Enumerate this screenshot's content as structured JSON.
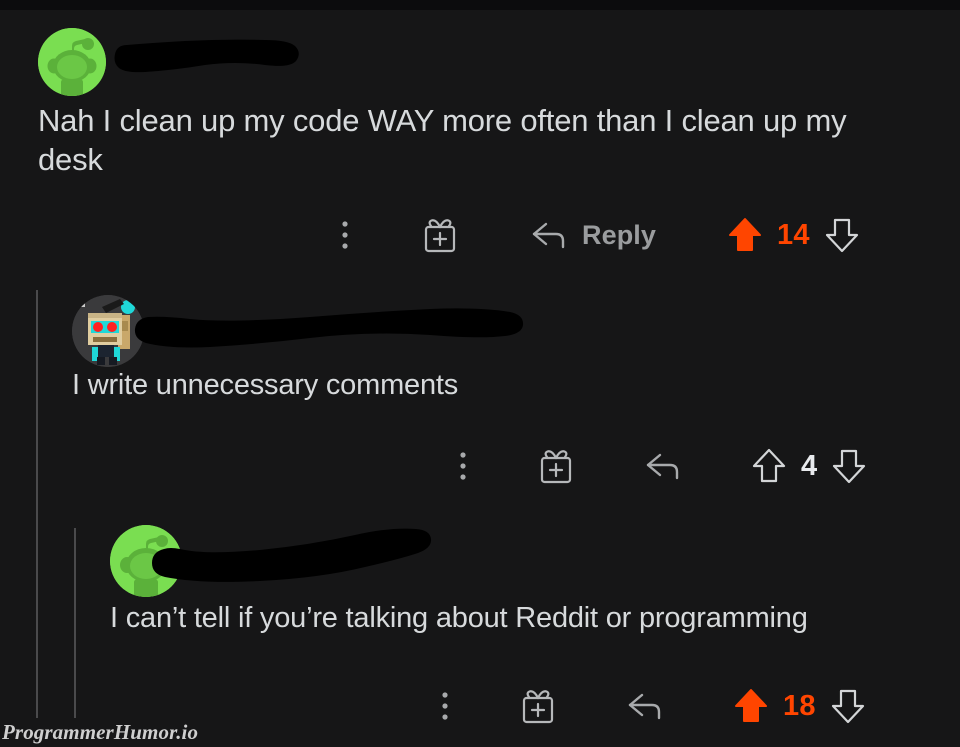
{
  "meta": {
    "platform": "reddit-comment-thread",
    "theme": "dark",
    "background_color": "#161617",
    "accent_color": "#ff4500",
    "text_color": "#d7dadc",
    "muted_color": "#9a9c9e",
    "thread_line_color": "#4a4a4c"
  },
  "watermark": {
    "text": "ProgrammerHumor.io"
  },
  "comments": [
    {
      "id": "comment-1",
      "depth": 0,
      "username_redacted": true,
      "avatar": "reddit-snoo-green-avatar",
      "body": "Nah I clean up my code WAY more often than I clean up my desk",
      "actions": {
        "overflow_label": "more-options",
        "award_label": "give-award",
        "reply_label": "Reply",
        "show_reply_text": true
      },
      "vote": {
        "count": "14",
        "upvoted": true,
        "downvoted": false
      }
    },
    {
      "id": "comment-2",
      "depth": 1,
      "username_redacted": true,
      "avatar": "cardboard-box-head-avatar",
      "body": "I write unnecessary comments",
      "actions": {
        "overflow_label": "more-options",
        "award_label": "give-award",
        "reply_label": "Reply",
        "show_reply_text": false
      },
      "vote": {
        "count": "4",
        "upvoted": false,
        "downvoted": false
      }
    },
    {
      "id": "comment-3",
      "depth": 2,
      "username_redacted": true,
      "avatar": "reddit-snoo-green-avatar",
      "body": "I can’t tell if you’re talking about Reddit or programming",
      "actions": {
        "overflow_label": "more-options",
        "award_label": "give-award",
        "reply_label": "Reply",
        "show_reply_text": false
      },
      "vote": {
        "count": "18",
        "upvoted": true,
        "downvoted": false
      }
    }
  ]
}
